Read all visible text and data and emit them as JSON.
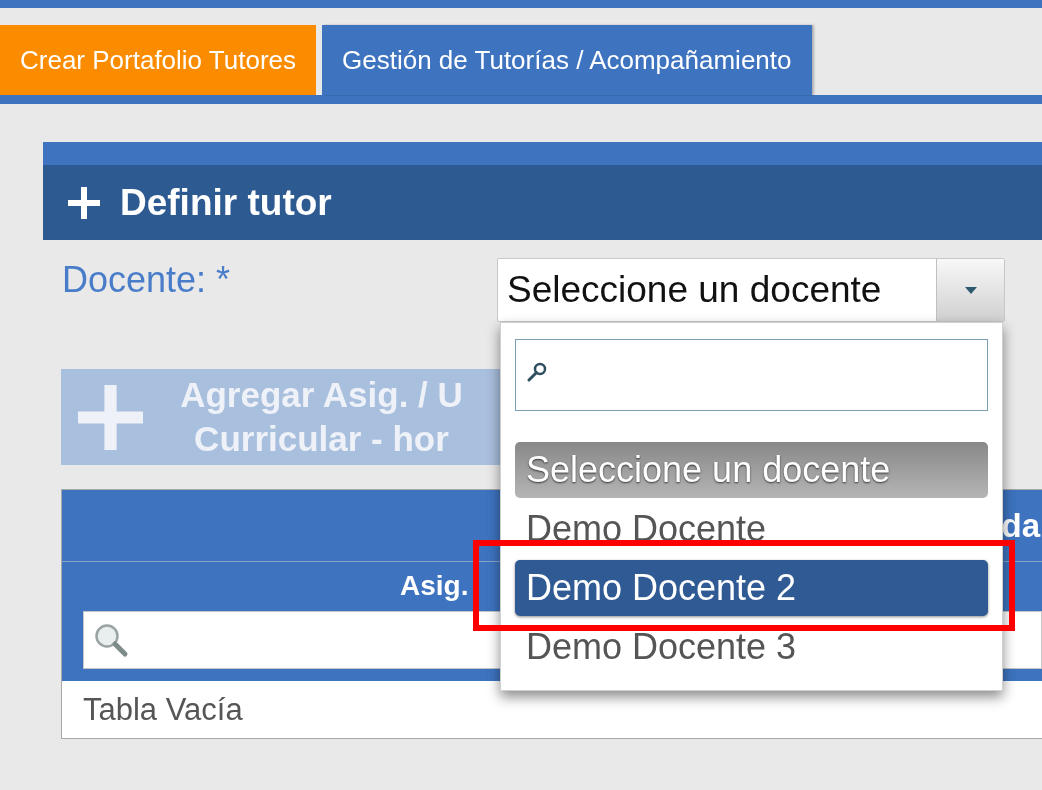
{
  "tabs": [
    {
      "label": "Crear Portafolio Tutores",
      "selected": false
    },
    {
      "label": "Gestión de Tutorías / Acompañamiento",
      "selected": true
    }
  ],
  "panel": {
    "title": "Definir tutor"
  },
  "form": {
    "docente": {
      "label": "Docente: *",
      "value": "Seleccione un docente",
      "expanded": true,
      "options": [
        {
          "label": "Seleccione un docente",
          "selected": true,
          "highlighted": false,
          "annotated": false
        },
        {
          "label": "Demo Docente",
          "selected": false,
          "highlighted": false,
          "annotated": false
        },
        {
          "label": "Demo Docente 2",
          "selected": false,
          "highlighted": true,
          "annotated": true
        },
        {
          "label": "Demo Docente 3",
          "selected": false,
          "highlighted": false,
          "annotated": false
        }
      ]
    }
  },
  "add_button": {
    "lines": [
      "Agregar Asig. / U",
      "Curricular - hor"
    ],
    "disabled": true
  },
  "table": {
    "title": "da",
    "columns": [
      "Asig."
    ],
    "empty_message": "Tabla Vacía"
  }
}
